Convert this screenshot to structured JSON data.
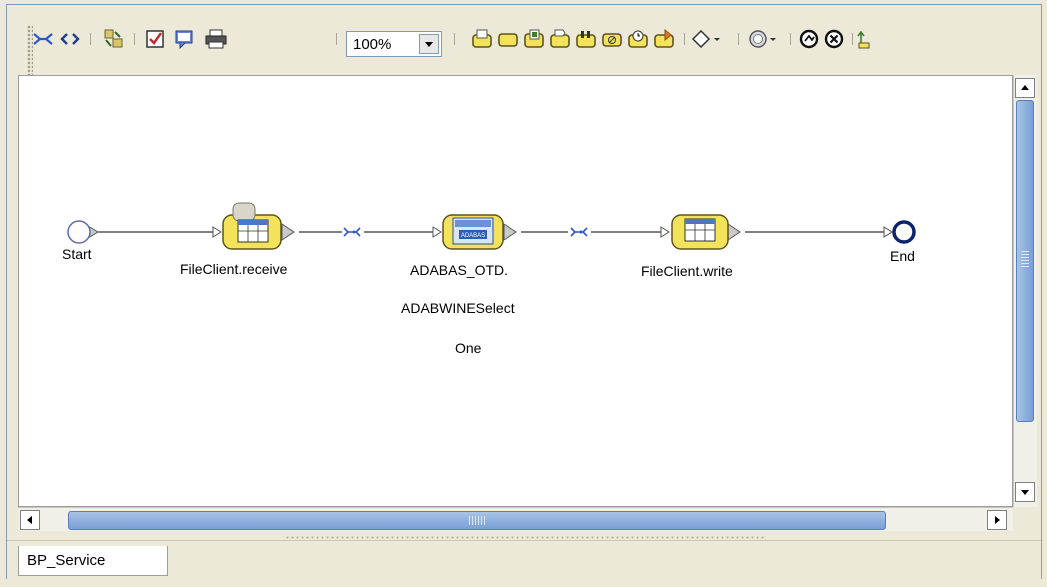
{
  "toolbar": {
    "zoom_value": "100%",
    "buttons": [
      {
        "name": "link-icon"
      },
      {
        "name": "code-icon"
      },
      {
        "name": "sync-icon"
      },
      {
        "name": "validate-icon"
      },
      {
        "name": "comment-icon"
      },
      {
        "name": "print-icon"
      },
      {
        "name": "activity-receive-icon"
      },
      {
        "name": "activity-icon"
      },
      {
        "name": "activity-assign-icon"
      },
      {
        "name": "activity-send-icon"
      },
      {
        "name": "activity-invoke-icon"
      },
      {
        "name": "activity-empty-icon"
      },
      {
        "name": "activity-wait-icon"
      },
      {
        "name": "activity-reply-icon"
      },
      {
        "name": "decision-icon"
      },
      {
        "name": "event-icon"
      },
      {
        "name": "compensate-icon"
      },
      {
        "name": "terminate-icon"
      }
    ]
  },
  "diagram": {
    "nodes": {
      "start": {
        "label": "Start"
      },
      "receive": {
        "label": "FileClient.receive"
      },
      "adabas": {
        "label_line1": "ADABAS_OTD.",
        "label_line2": "ADABWINESelect",
        "label_line3": "One",
        "icon_text": "ADABAS"
      },
      "write": {
        "label": "FileClient.write"
      },
      "end": {
        "label": "End"
      }
    }
  },
  "tabs": [
    {
      "label": "BP_Service",
      "active": true
    }
  ],
  "colors": {
    "accent": "#0a246a",
    "node_yellow": "#f2e35a",
    "thumb": "#8fb0df"
  }
}
